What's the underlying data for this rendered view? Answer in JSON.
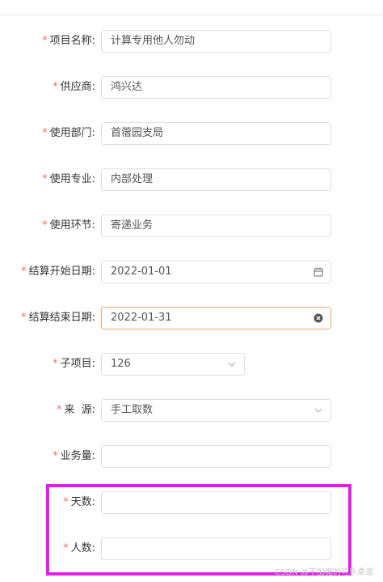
{
  "form": {
    "rows": [
      {
        "label": "项目名称:",
        "value": "计算专用他人勿动"
      },
      {
        "label": "供应商:",
        "value": "鸿兴达"
      },
      {
        "label": "使用部门:",
        "value": "首蓿园支局"
      },
      {
        "label": "使用专业:",
        "value": "内部处理"
      },
      {
        "label": "使用环节:",
        "value": "寄递业务"
      },
      {
        "label": "结算开始日期:",
        "value": "2022-01-01"
      },
      {
        "label": "结算结束日期:",
        "value": "2022-01-31"
      },
      {
        "label": "子项目:",
        "value": "126"
      },
      {
        "label": "来  源:",
        "value": "手工取数"
      },
      {
        "label": "业务量:",
        "value": ""
      },
      {
        "label": "天数:",
        "value": ""
      },
      {
        "label": "人数:",
        "value": ""
      }
    ],
    "required_mark": "*"
  },
  "icons": {
    "date_start": "calendar-icon",
    "date_end": "clear-circle-icon",
    "select": "chevron-down-icon"
  },
  "colors": {
    "required": "#f56c6c",
    "focus_border": "#f0a86c",
    "annotation": "#e31ee8"
  },
  "watermark": "CSDN @不加糖的可乐桌道"
}
